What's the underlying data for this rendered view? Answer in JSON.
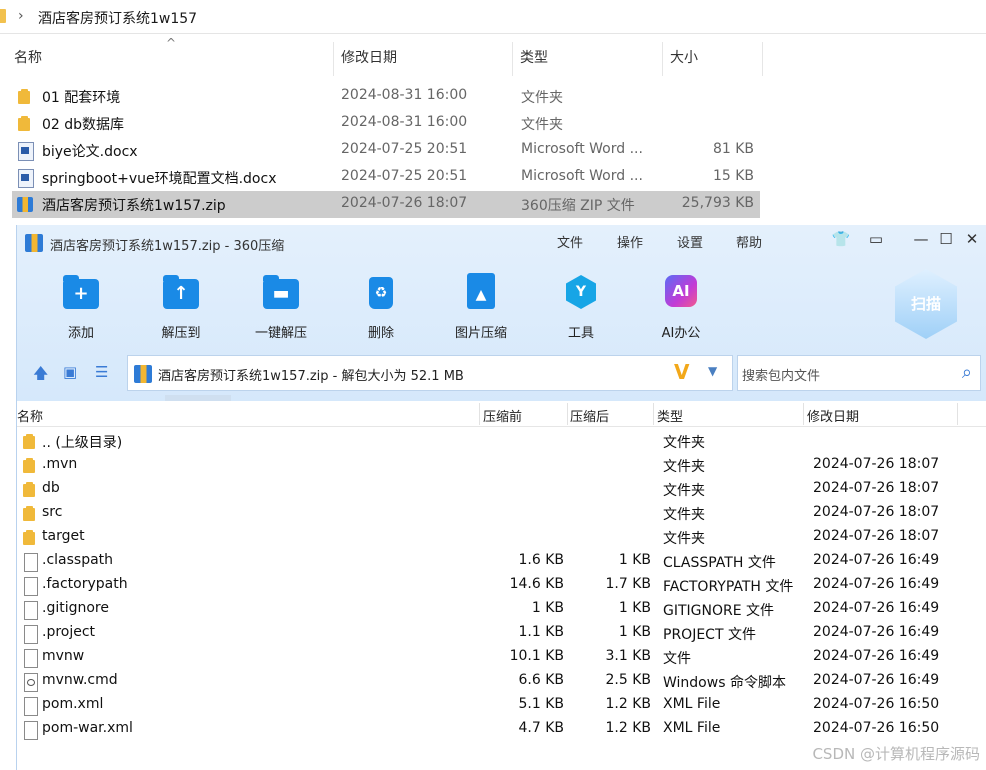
{
  "explorer": {
    "path": "酒店客房预订系统1w157",
    "columns": {
      "name": "名称",
      "date": "修改日期",
      "type": "类型",
      "size": "大小"
    },
    "rows": [
      {
        "name": "01 配套环境",
        "date": "2024-08-31 16:00",
        "type": "文件夹",
        "size": "",
        "icon": "folder-icon"
      },
      {
        "name": "02 db数据库",
        "date": "2024-08-31 16:00",
        "type": "文件夹",
        "size": "",
        "icon": "folder-icon"
      },
      {
        "name": "biye论文.docx",
        "date": "2024-07-25 20:51",
        "type": "Microsoft Word ...",
        "size": "81 KB",
        "icon": "word-doc-icon"
      },
      {
        "name": "springboot+vue环境配置文档.docx",
        "date": "2024-07-25 20:51",
        "type": "Microsoft Word ...",
        "size": "15 KB",
        "icon": "word-doc-icon"
      },
      {
        "name": "酒店客房预订系统1w157.zip",
        "date": "2024-07-26 18:07",
        "type": "360压缩 ZIP 文件",
        "size": "25,793 KB",
        "icon": "zip-archive-icon",
        "selected": true
      }
    ]
  },
  "zipper": {
    "title": "酒店客房预订系统1w157.zip - 360压缩",
    "menu": [
      "文件",
      "操作",
      "设置",
      "帮助"
    ],
    "toolbar": [
      {
        "label": "添加",
        "icon": "add-icon"
      },
      {
        "label": "解压到",
        "icon": "extract-to-icon"
      },
      {
        "label": "一键解压",
        "icon": "one-click-extract-icon"
      },
      {
        "label": "删除",
        "icon": "delete-icon"
      },
      {
        "label": "图片压缩",
        "icon": "image-compress-icon"
      },
      {
        "label": "工具",
        "icon": "tools-icon"
      },
      {
        "label": "AI办公",
        "icon": "ai-office-icon"
      }
    ],
    "ai_badge": "AI",
    "scan_label": "扫描",
    "address": "酒店客房预订系统1w157.zip - 解包大小为 52.1 MB",
    "search_placeholder": "搜索包内文件",
    "columns": {
      "name": "名称",
      "compressed": "压缩前",
      "uncompressed": "压缩后",
      "type": "类型",
      "date": "修改日期"
    },
    "rows": [
      {
        "name": ".. (上级目录)",
        "before": "",
        "after": "",
        "type": "文件夹",
        "date": "",
        "icon": "folder-icon"
      },
      {
        "name": ".mvn",
        "before": "",
        "after": "",
        "type": "文件夹",
        "date": "2024-07-26 18:07",
        "icon": "folder-icon"
      },
      {
        "name": "db",
        "before": "",
        "after": "",
        "type": "文件夹",
        "date": "2024-07-26 18:07",
        "icon": "folder-icon"
      },
      {
        "name": "src",
        "before": "",
        "after": "",
        "type": "文件夹",
        "date": "2024-07-26 18:07",
        "icon": "folder-icon"
      },
      {
        "name": "target",
        "before": "",
        "after": "",
        "type": "文件夹",
        "date": "2024-07-26 18:07",
        "icon": "folder-icon"
      },
      {
        "name": ".classpath",
        "before": "1.6 KB",
        "after": "1 KB",
        "type": "CLASSPATH 文件",
        "date": "2024-07-26 16:49",
        "icon": "file-icon"
      },
      {
        "name": ".factorypath",
        "before": "14.6 KB",
        "after": "1.7 KB",
        "type": "FACTORYPATH 文件",
        "date": "2024-07-26 16:49",
        "icon": "file-icon"
      },
      {
        "name": ".gitignore",
        "before": "1 KB",
        "after": "1 KB",
        "type": "GITIGNORE 文件",
        "date": "2024-07-26 16:49",
        "icon": "file-icon"
      },
      {
        "name": ".project",
        "before": "1.1 KB",
        "after": "1 KB",
        "type": "PROJECT 文件",
        "date": "2024-07-26 16:49",
        "icon": "file-icon"
      },
      {
        "name": "mvnw",
        "before": "10.1 KB",
        "after": "3.1 KB",
        "type": "文件",
        "date": "2024-07-26 16:49",
        "icon": "file-icon"
      },
      {
        "name": "mvnw.cmd",
        "before": "6.6 KB",
        "after": "2.5 KB",
        "type": "Windows 命令脚本",
        "date": "2024-07-26 16:49",
        "icon": "cmd-script-icon"
      },
      {
        "name": "pom.xml",
        "before": "5.1 KB",
        "after": "1.2 KB",
        "type": "XML File",
        "date": "2024-07-26 16:50",
        "icon": "file-icon"
      },
      {
        "name": "pom-war.xml",
        "before": "4.7 KB",
        "after": "1.2 KB",
        "type": "XML File",
        "date": "2024-07-26 16:50",
        "icon": "file-icon"
      }
    ]
  },
  "watermark": "CSDN @计算机程序源码"
}
